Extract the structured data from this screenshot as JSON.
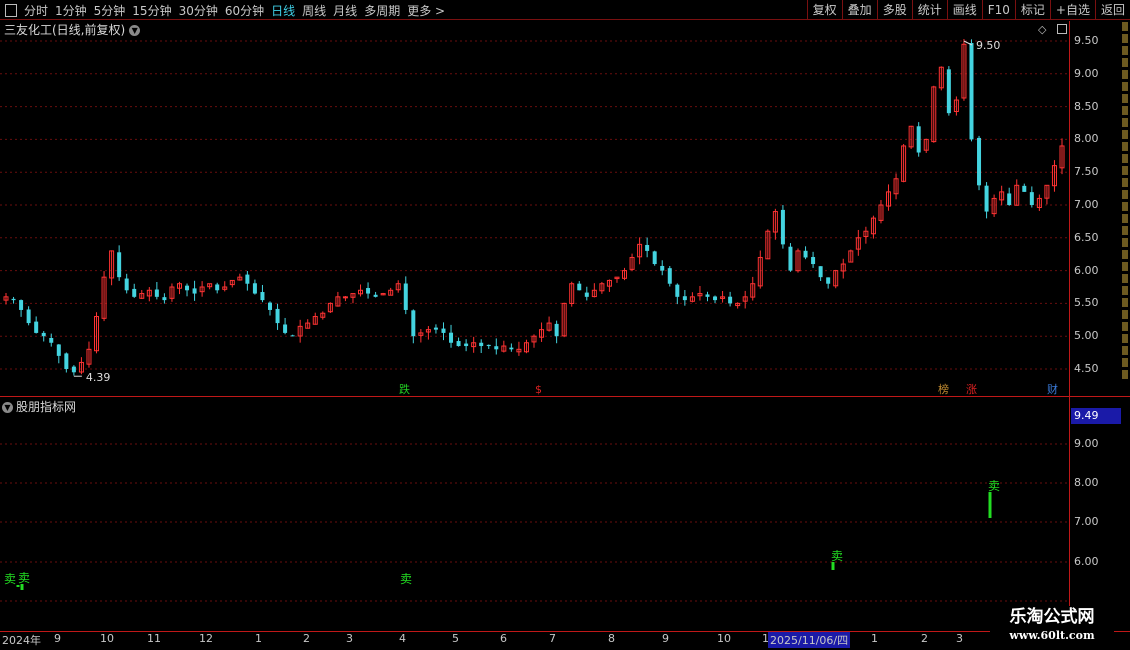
{
  "toolbar": {
    "periods": [
      "分时",
      "1分钟",
      "5分钟",
      "15分钟",
      "30分钟",
      "60分钟",
      "日线",
      "周线",
      "月线",
      "多周期",
      "更多 >"
    ],
    "active_period": "日线",
    "actions": [
      "复权",
      "叠加",
      "多股",
      "统计",
      "画线",
      "F10",
      "标记",
      "+自选",
      "返回"
    ]
  },
  "main_chart": {
    "title": "三友化工(日线,前复权)",
    "price_ticks": [
      "9.50",
      "9.00",
      "8.50",
      "8.00",
      "7.50",
      "7.00",
      "6.50",
      "6.00",
      "5.50",
      "5.00",
      "4.50"
    ],
    "high_marker": "9.50",
    "low_marker": "4.39",
    "event_tags": [
      {
        "text": "跌",
        "color": "#22cc22"
      },
      {
        "text": "$",
        "color": "#dd2222"
      },
      {
        "text": "榜",
        "color": "#c08a30"
      },
      {
        "text": "涨",
        "color": "#dd2222"
      },
      {
        "text": "财",
        "color": "#3a7ad8"
      }
    ]
  },
  "indicator": {
    "title": "股朋指标网",
    "current_value": "9.49",
    "ticks": [
      "9.00",
      "8.00",
      "7.00",
      "6.00"
    ],
    "signal_label": "卖",
    "signals_x": [
      "卖",
      "卖",
      "卖",
      "卖",
      "卖"
    ]
  },
  "date_axis": {
    "labels": [
      "2024年",
      "9",
      "10",
      "11",
      "12",
      "1",
      "2",
      "3",
      "4",
      "5",
      "6",
      "7",
      "8",
      "9",
      "10",
      "1",
      "2025/11/06/四",
      "1",
      "2",
      "3"
    ]
  },
  "watermark": {
    "line1": "乐淘公式网",
    "line2": "www.60lt.com"
  },
  "colors": {
    "up": "#ff3333",
    "down": "#44d4e0",
    "buy_sell": "#22dd22",
    "grid": "#7a1010"
  },
  "chart_data": {
    "type": "candlestick",
    "ylim": [
      4.2,
      9.7
    ],
    "close_series": [
      5.6,
      5.55,
      5.4,
      5.2,
      5.05,
      5.0,
      4.9,
      4.7,
      4.5,
      4.45,
      4.6,
      4.8,
      5.3,
      5.9,
      6.3,
      5.9,
      5.7,
      5.6,
      5.65,
      5.7,
      5.6,
      5.55,
      5.75,
      5.8,
      5.7,
      5.65,
      5.75,
      5.8,
      5.7,
      5.75,
      5.85,
      5.9,
      5.8,
      5.65,
      5.55,
      5.4,
      5.2,
      5.05,
      5.0,
      5.15,
      5.2,
      5.3,
      5.35,
      5.5,
      5.6,
      5.6,
      5.65,
      5.7,
      5.65,
      5.6,
      5.65,
      5.7,
      5.8,
      5.4,
      5.0,
      5.05,
      5.1,
      5.1,
      5.05,
      4.9,
      4.85,
      4.85,
      4.9,
      4.85,
      4.85,
      4.8,
      4.85,
      4.8,
      4.8,
      4.9,
      5.0,
      5.1,
      5.2,
      5.0,
      5.5,
      5.8,
      5.7,
      5.6,
      5.7,
      5.8,
      5.85,
      5.9,
      6.0,
      6.2,
      6.4,
      6.3,
      6.1,
      6.0,
      5.8,
      5.6,
      5.55,
      5.6,
      5.65,
      5.6,
      5.55,
      5.6,
      5.5,
      5.5,
      5.6,
      5.8,
      6.2,
      6.6,
      6.9,
      6.4,
      6.0,
      6.3,
      6.2,
      6.1,
      5.9,
      5.8,
      6.0,
      6.1,
      6.3,
      6.5,
      6.6,
      6.8,
      7.0,
      7.2,
      7.4,
      7.9,
      8.2,
      7.8,
      8.0,
      8.8,
      9.1,
      8.4,
      8.6,
      9.45,
      8.0,
      7.3,
      6.9,
      7.1,
      7.2,
      7.0,
      7.3,
      7.2,
      7.0,
      7.1,
      7.3,
      7.6,
      7.9
    ]
  }
}
